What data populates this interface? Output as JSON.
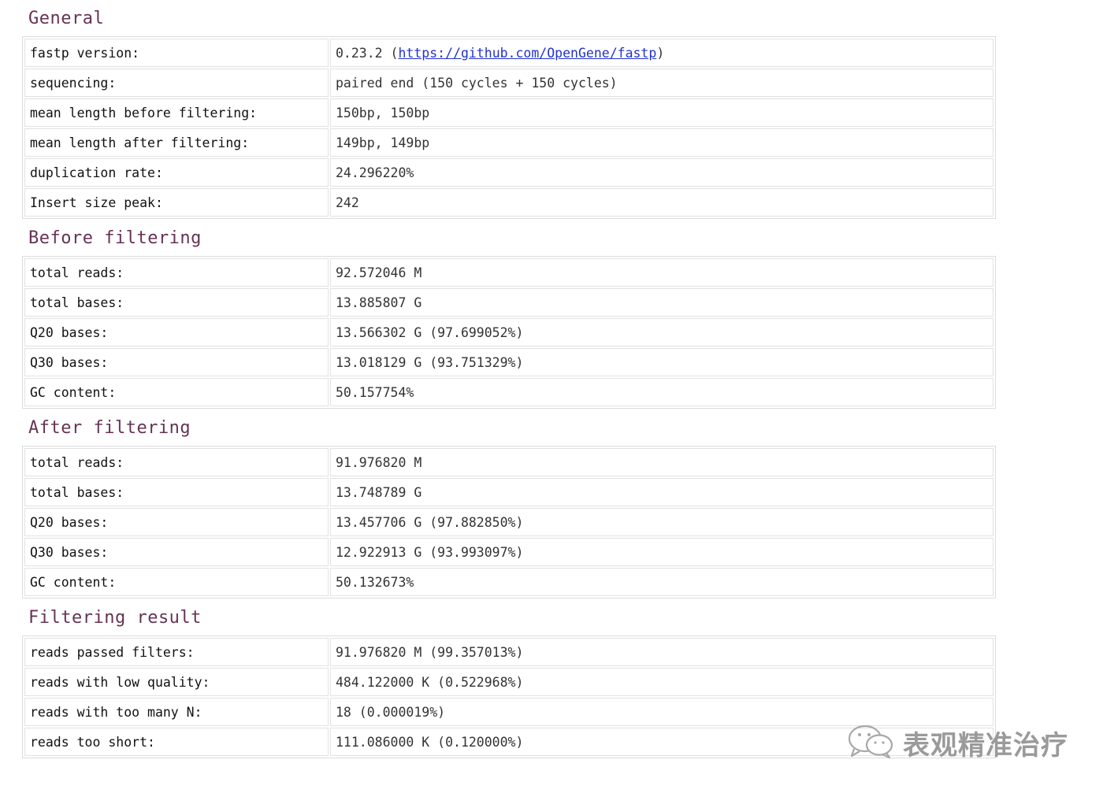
{
  "sections": [
    {
      "title": "General",
      "rows": [
        {
          "label": "fastp version:",
          "value": "0.23.2",
          "link_prefix": " (",
          "link": "https://github.com/OpenGene/fastp",
          "link_suffix": ")"
        },
        {
          "label": "sequencing:",
          "value": "paired end (150 cycles + 150 cycles)"
        },
        {
          "label": "mean length before filtering:",
          "value": "150bp, 150bp"
        },
        {
          "label": "mean length after filtering:",
          "value": "149bp, 149bp"
        },
        {
          "label": "duplication rate:",
          "value": "24.296220%"
        },
        {
          "label": "Insert size peak:",
          "value": "242"
        }
      ]
    },
    {
      "title": "Before filtering",
      "rows": [
        {
          "label": "total reads:",
          "value": "92.572046 M"
        },
        {
          "label": "total bases:",
          "value": "13.885807 G"
        },
        {
          "label": "Q20 bases:",
          "value": "13.566302 G (97.699052%)"
        },
        {
          "label": "Q30 bases:",
          "value": "13.018129 G (93.751329%)"
        },
        {
          "label": "GC content:",
          "value": "50.157754%"
        }
      ]
    },
    {
      "title": "After filtering",
      "rows": [
        {
          "label": "total reads:",
          "value": "91.976820 M"
        },
        {
          "label": "total bases:",
          "value": "13.748789 G"
        },
        {
          "label": "Q20 bases:",
          "value": "13.457706 G (97.882850%)"
        },
        {
          "label": "Q30 bases:",
          "value": "12.922913 G (93.993097%)"
        },
        {
          "label": "GC content:",
          "value": "50.132673%"
        }
      ]
    },
    {
      "title": "Filtering result",
      "rows": [
        {
          "label": "reads passed filters:",
          "value": "91.976820 M (99.357013%)"
        },
        {
          "label": "reads with low quality:",
          "value": "484.122000 K (0.522968%)"
        },
        {
          "label": "reads with too many N:",
          "value": "18 (0.000019%)"
        },
        {
          "label": "reads too short:",
          "value": "111.086000 K (0.120000%)"
        }
      ]
    }
  ],
  "watermark": {
    "text": "表观精准治疗",
    "icon": "wechat-icon"
  },
  "colors": {
    "section_title": "#663355",
    "link": "#2233cc",
    "border": "#dcdcdc",
    "watermark": "#9a9a9a"
  }
}
